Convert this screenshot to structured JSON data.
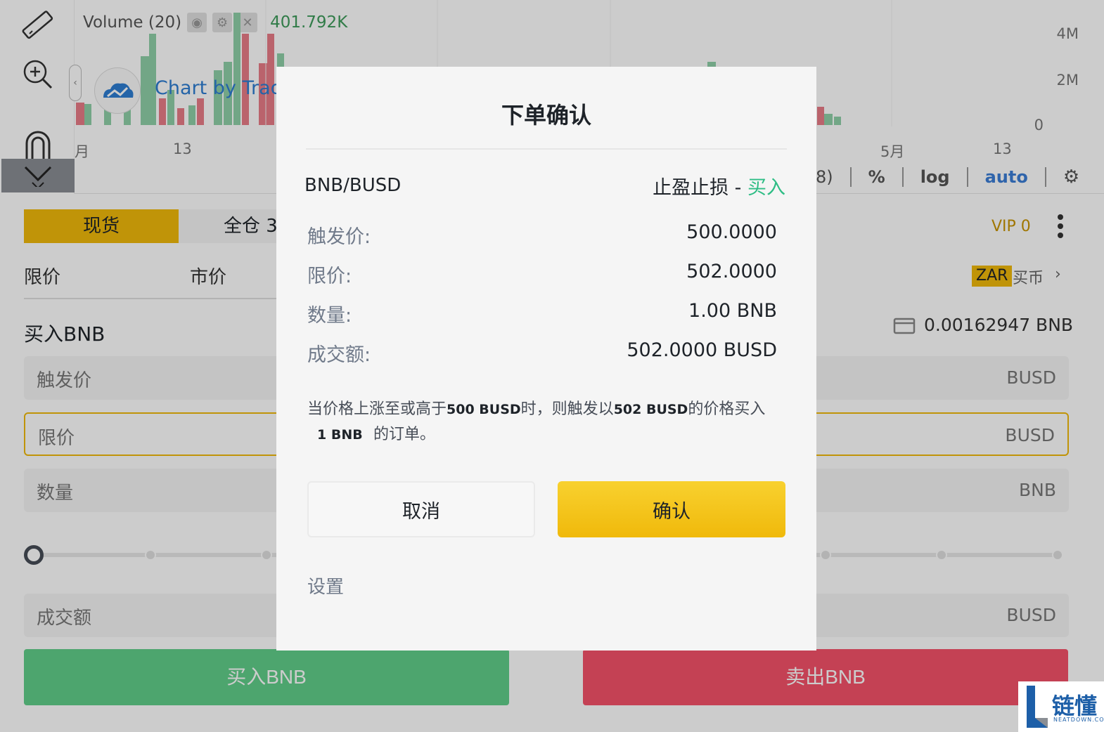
{
  "chart": {
    "volume_label": "Volume (20)",
    "volume_value": "401.792K",
    "tv_attribution": "Chart by Trad",
    "y_ticks": [
      "4M",
      "2M",
      "0"
    ],
    "x_ticks": [
      "月",
      "13",
      "5月",
      "13"
    ],
    "options": {
      "partial": "8)",
      "percent": "%",
      "log": "log",
      "auto": "auto"
    }
  },
  "panel": {
    "tab_spot": "现货",
    "tab_cross": "全仓 3",
    "vip": "VIP 0",
    "order_type_limit": "限价",
    "order_type_market": "市价",
    "zar": "ZAR",
    "buy_crypto": "买币",
    "buy_chevron": "›",
    "buy_title": "买入BNB",
    "balance": "0.00162947 BNB",
    "inputs": {
      "trigger_label": "触发价",
      "trigger_unit": "BUSD",
      "limit_label": "限价",
      "limit_unit": "BUSD",
      "amount_label": "数量",
      "amount_unit": "BNB",
      "total_label": "成交额",
      "total_unit": "BUSD"
    },
    "buy_button": "买入BNB",
    "sell_button": "卖出BNB"
  },
  "modal": {
    "title": "下单确认",
    "pair": "BNB/BUSD",
    "order_type": "止盈止损 - ",
    "side": "买入",
    "rows": {
      "trigger_key": "触发价:",
      "trigger_val": "500.0000",
      "limit_key": "限价:",
      "limit_val": "502.0000",
      "qty_key": "数量:",
      "qty_val": "1.00 BNB",
      "total_key": "成交额:",
      "total_val": "502.0000 BUSD"
    },
    "note": {
      "p1": "当价格上涨至或高于",
      "trigger": "500 BUSD",
      "p2": "时，则触发以",
      "limit": "502 BUSD",
      "p3": "的价格买入",
      "qty": "1 BNB",
      "p4": "的订单。"
    },
    "cancel": "取消",
    "confirm": "确认",
    "settings": "设置"
  },
  "watermark": {
    "text": "链懂",
    "sub": "NEATDOWN.COM"
  },
  "colors": {
    "accent_yellow": "#F0B90B",
    "buy_green": "#61CF8A",
    "sell_red": "#F5526A",
    "side_green": "#2EBD85"
  }
}
